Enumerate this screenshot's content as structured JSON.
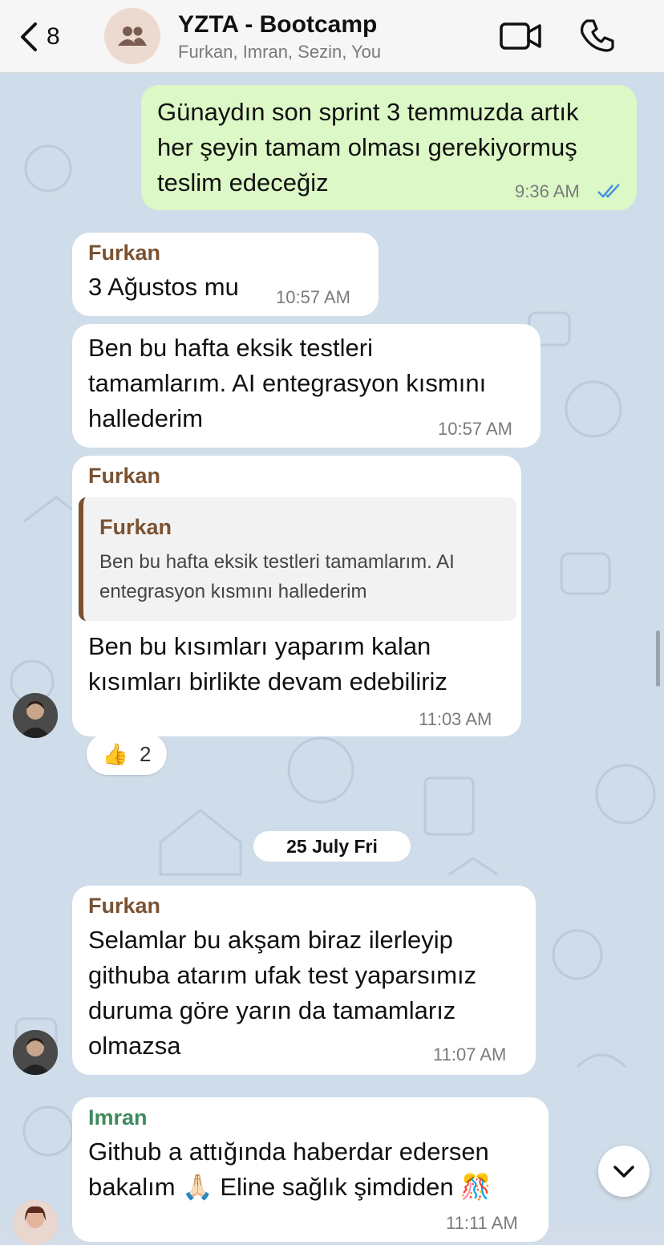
{
  "header": {
    "back_count": "8",
    "title": "YZTA - Bootcamp",
    "subtitle": "Furkan, Imran, Sezin, You",
    "icons": [
      "chevron-left-icon",
      "group-icon",
      "video-call-icon",
      "phone-icon"
    ]
  },
  "colors": {
    "outgoing_bubble": "#dcf8c6",
    "incoming_bubble": "#ffffff",
    "furkan_name": "#7a5232",
    "imran_name": "#3e8a5c",
    "read_ticks": "#4a90e2"
  },
  "messages": [
    {
      "direction": "out",
      "text": "Günaydın son sprint 3 temmuzda artık\nher şeyin tamam olması gerekiyormuş\nteslim edeceğiz",
      "time": "9:36 AM",
      "status": "read"
    },
    {
      "direction": "in",
      "sender": "Furkan",
      "text": "3 Ağustos mu",
      "time": "10:57 AM"
    },
    {
      "direction": "in",
      "text": "Ben bu hafta eksik testleri\ntamamlarım. AI entegrasyon kısmını\nhallederim",
      "time": "10:57 AM"
    },
    {
      "direction": "in",
      "sender": "Furkan",
      "quote": {
        "sender": "Furkan",
        "text": "Ben bu hafta eksik testleri tamamlarım. AI\nentegrasyon kısmını hallederim"
      },
      "text": "Ben bu kısımları yaparım kalan\nkısımları birlikte devam edebiliriz",
      "time": "11:03 AM",
      "reaction": {
        "emoji": "👍",
        "count": "2"
      }
    },
    {
      "direction": "in",
      "sender": "Furkan",
      "text": "Selamlar bu akşam biraz ilerleyip\ngithuba atarım ufak test yaparsımız\nduruma göre yarın da tamamlarız\nolmazsa",
      "time": "11:07 AM"
    },
    {
      "direction": "in",
      "sender": "Imran",
      "text": "Github a attığında haberdar edersen\nbakalım 🙏🏻 Eline sağlık şimdiden 🎊",
      "time": "11:11 AM"
    }
  ],
  "date_separator": "25 July Fri",
  "scroll_down_icon": "chevron-down-icon"
}
